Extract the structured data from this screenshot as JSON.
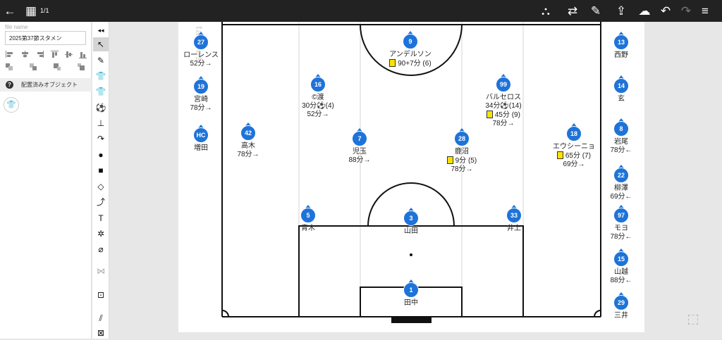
{
  "topbar": {
    "back_icon": "←",
    "calendar_icon": "▦",
    "page_indicator": "1/1",
    "icons": [
      {
        "name": "share-network-icon",
        "glyph": "⛬"
      },
      {
        "name": "substitution-icon",
        "glyph": "⇄"
      },
      {
        "name": "edit-list-icon",
        "glyph": "✎"
      },
      {
        "name": "export-icon",
        "glyph": "⇪"
      },
      {
        "name": "cloud-upload-icon",
        "glyph": "☁"
      },
      {
        "name": "undo-icon",
        "glyph": "↶"
      },
      {
        "name": "redo-icon",
        "glyph": "↷"
      },
      {
        "name": "menu-icon",
        "glyph": "≡"
      }
    ]
  },
  "left_panel": {
    "file_name_label": "file name",
    "file_name_value": "2025第37節スタメン",
    "placed_objects_label": "配置済みオブジェクト",
    "help_icon": "?",
    "shirt_icon": "👕"
  },
  "toolbar": {
    "collapse": "◂◂",
    "tools": [
      "↖",
      "✎",
      "👕",
      "👕",
      "⚽",
      "⊥",
      "↷",
      "●",
      "■",
      "◇",
      "⤴",
      "T",
      "✲",
      "⌀",
      "⋈",
      "⊡",
      "⫽",
      "⊠"
    ]
  },
  "watermark": "tactics",
  "accent": "#1e73d8",
  "players": [
    {
      "id": "p27",
      "num": "27",
      "lines": [
        "ローレンス",
        "52分→"
      ]
    },
    {
      "id": "p19",
      "num": "19",
      "lines": [
        "宮崎",
        "78分→"
      ]
    },
    {
      "id": "pHC",
      "num": "HC",
      "lines": [
        "増田"
      ]
    },
    {
      "id": "p42",
      "num": "42",
      "lines": [
        "高木",
        "78分→"
      ]
    },
    {
      "id": "p16",
      "num": "16",
      "lines": [
        "©渡",
        "30分⚽(4)",
        "52分→"
      ]
    },
    {
      "id": "p9",
      "num": "9",
      "lines": [
        "アンデルソン",
        "90+7分 (6)"
      ]
    },
    {
      "id": "p7",
      "num": "7",
      "lines": [
        "児玉",
        "88分→"
      ]
    },
    {
      "id": "p28",
      "num": "28",
      "lines": [
        "鹿沼",
        "9分 (5)",
        "78分→"
      ]
    },
    {
      "id": "p99",
      "num": "99",
      "lines": [
        "バルセロス",
        "34分⚽(14)",
        "45分 (9)",
        "78分→"
      ]
    },
    {
      "id": "p18",
      "num": "18",
      "lines": [
        "エウシーニョ",
        "65分 (7)",
        "69分→"
      ]
    },
    {
      "id": "p5",
      "num": "5",
      "lines": [
        "青木"
      ]
    },
    {
      "id": "p3",
      "num": "3",
      "lines": [
        "山田"
      ]
    },
    {
      "id": "p33",
      "num": "33",
      "lines": [
        "井上"
      ]
    },
    {
      "id": "p1",
      "num": "1",
      "lines": [
        "田中"
      ]
    },
    {
      "id": "p13",
      "num": "13",
      "lines": [
        "西野"
      ]
    },
    {
      "id": "p14",
      "num": "14",
      "lines": [
        "玄"
      ]
    },
    {
      "id": "p8",
      "num": "8",
      "lines": [
        "岩尾",
        "78分←"
      ]
    },
    {
      "id": "p22",
      "num": "22",
      "lines": [
        "柳澤",
        "69分←"
      ]
    },
    {
      "id": "p97",
      "num": "97",
      "lines": [
        "モヨ",
        "78分←"
      ]
    },
    {
      "id": "p15",
      "num": "15",
      "lines": [
        "山越",
        "88分←"
      ]
    },
    {
      "id": "p29",
      "num": "29",
      "lines": [
        "三井"
      ]
    }
  ]
}
